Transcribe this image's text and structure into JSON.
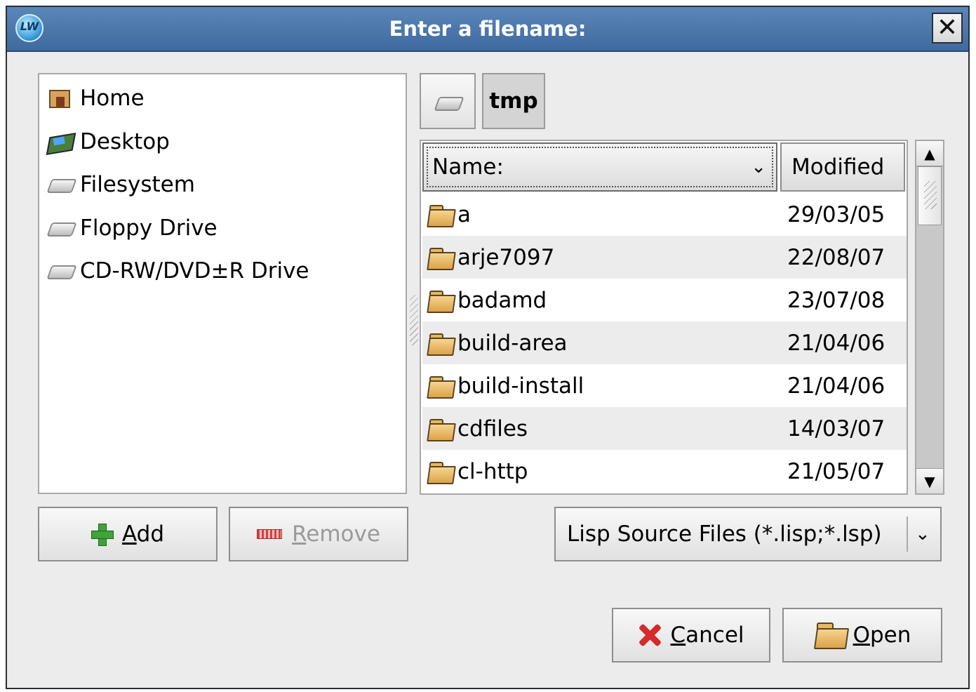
{
  "window": {
    "title": "Enter a filename:",
    "app_icon_text": "LW",
    "close_label": "✕"
  },
  "places": [
    {
      "label": "Home",
      "icon": "home-folder-icon"
    },
    {
      "label": "Desktop",
      "icon": "desktop-icon"
    },
    {
      "label": "Filesystem",
      "icon": "drive-icon"
    },
    {
      "label": "Floppy Drive",
      "icon": "drive-icon"
    },
    {
      "label": "CD-RW/DVD±R Drive",
      "icon": "drive-icon"
    }
  ],
  "bookmark_buttons": {
    "add": {
      "underline": "A",
      "rest": "dd"
    },
    "remove": {
      "underline": "R",
      "rest": "emove"
    }
  },
  "path_bar": {
    "current": "tmp"
  },
  "file_list": {
    "columns": {
      "name": "Name:",
      "modified": "Modified"
    },
    "rows": [
      {
        "name": "a",
        "modified": "29/03/05"
      },
      {
        "name": "arje7097",
        "modified": "22/08/07"
      },
      {
        "name": "badamd",
        "modified": "23/07/08"
      },
      {
        "name": "build-area",
        "modified": "21/04/06"
      },
      {
        "name": "build-install",
        "modified": "21/04/06"
      },
      {
        "name": "cdfiles",
        "modified": "14/03/07"
      },
      {
        "name": "cl-http",
        "modified": "21/05/07"
      }
    ]
  },
  "filter": {
    "selected": "Lisp Source Files (*.lisp;*.lsp)"
  },
  "actions": {
    "cancel": {
      "underline": "C",
      "rest": "ancel"
    },
    "open": {
      "underline": "O",
      "rest": "pen"
    }
  },
  "colors": {
    "titlebar": "#4a76ab",
    "dialog_bg": "#ececec",
    "row_alt": "#ececec",
    "cancel_icon": "#d42b2b",
    "add_icon": "#3fa33a"
  }
}
